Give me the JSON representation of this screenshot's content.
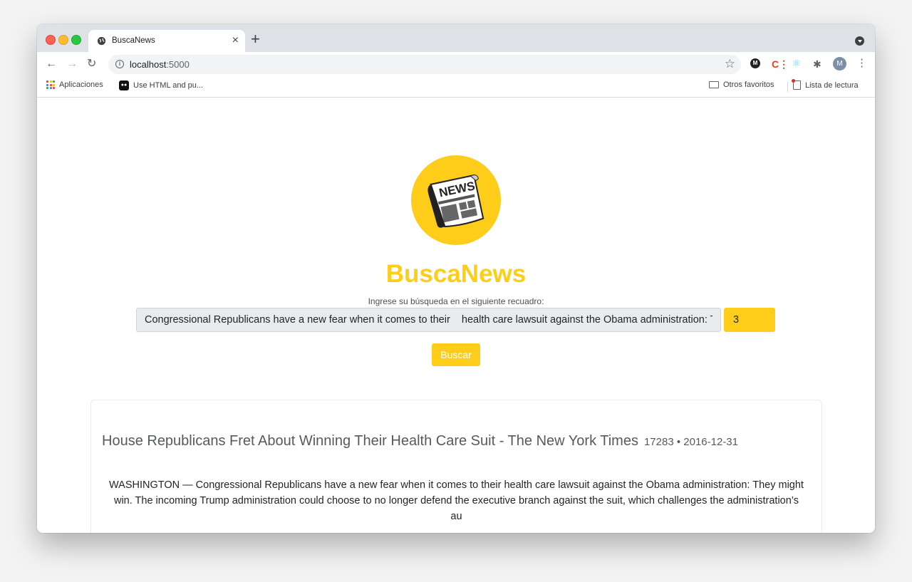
{
  "browser": {
    "tab_title": "BuscaNews",
    "tab_close": "×",
    "new_tab": "+",
    "url_host": "localhost",
    "url_port": ":5000",
    "profile_initial": "M",
    "bookmarks": {
      "apps": "Aplicaciones",
      "html": "Use HTML and pu...",
      "otros": "Otros favoritos",
      "lectura": "Lista de lectura"
    }
  },
  "page": {
    "brand": "BuscaNews",
    "logo_text": "NEWS",
    "prompt": "Ingrese su búsqueda en el siguiente recuadro:",
    "query_value": "Congressional Republicans have a new fear when it comes to their    health care lawsuit against the Obama administration: They might win.",
    "count_value": "3",
    "search_button": "Buscar",
    "accent_color": "#fecd1a"
  },
  "results": [
    {
      "title": "House Republicans Fret About Winning Their Health Care Suit - The New York Times",
      "meta": "17283 • 2016-12-31",
      "snippet": "WASHINGTON — Congressional Republicans have a new fear when it comes to their health care lawsuit against the Obama administration: They might win. The incoming Trump administration could choose to no longer defend the executive branch against the suit, which challenges the administration’s au"
    }
  ]
}
